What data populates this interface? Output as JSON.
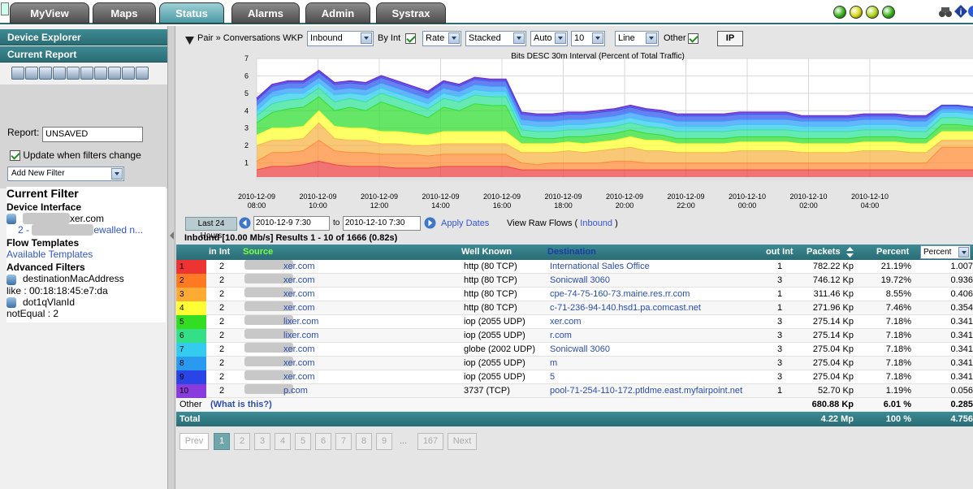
{
  "tabs": [
    {
      "label": "MyView"
    },
    {
      "label": "Maps"
    },
    {
      "label": "Status"
    },
    {
      "label": "Alarms"
    },
    {
      "label": "Admin"
    },
    {
      "label": "Systrax"
    }
  ],
  "status_balls": [
    "#2faf0c",
    "#d6d60a",
    "#a7d110",
    "#2faf0c"
  ],
  "left": {
    "device_explorer": "Device Explorer",
    "current_report": "Current Report",
    "report_label": "Report:",
    "report_value": "UNSAVED",
    "update_label": "Update when filters change",
    "add_filter": "Add New Filter",
    "current_filter": "Current Filter",
    "device_interface": "Device Interface",
    "device_host": "xer.com",
    "device_iface": "2 -",
    "device_iface_tail": "ewalled n...",
    "flow_templates": "Flow Templates",
    "available_templates": "Available Templates",
    "advanced_filters": "Advanced Filters",
    "filter1_name": "destinationMacAddress",
    "filter1_value": "like : 00:18:18:45:e7:da",
    "filter2_name": "dot1qVlanId",
    "filter2_value": "notEqual : 2"
  },
  "controls": {
    "pair_label": "Pair » Conversations WKP",
    "direction": "Inbound",
    "by_int": "By Int",
    "rate": "Rate",
    "stacked": "Stacked",
    "auto": "Auto",
    "count": "10",
    "line": "Line",
    "other": "Other",
    "ip": "IP"
  },
  "chart_data": {
    "type": "area",
    "title": "Bits DESC 30m Interval (Percent of Total Traffic)",
    "y_ticks": [
      "7",
      "6",
      "5",
      "4",
      "3",
      "2",
      "1"
    ],
    "x_ticks": [
      [
        "2010-12-09",
        "08:00"
      ],
      [
        "2010-12-09",
        "10:00"
      ],
      [
        "2010-12-09",
        "12:00"
      ],
      [
        "2010-12-09",
        "14:00"
      ],
      [
        "2010-12-09",
        "16:00"
      ],
      [
        "2010-12-09",
        "18:00"
      ],
      [
        "2010-12-09",
        "20:00"
      ],
      [
        "2010-12-09",
        "22:00"
      ],
      [
        "2010-12-10",
        "00:00"
      ],
      [
        "2010-12-10",
        "02:00"
      ],
      [
        "2010-12-10",
        "04:00"
      ]
    ],
    "ylim": [
      0,
      7
    ],
    "series_colors": [
      "#ee4444",
      "#ff8c3a",
      "#f6b64a",
      "#ffff33",
      "#33dd33",
      "#33e29a",
      "#33ccee",
      "#3399ff",
      "#3355ee",
      "#6a3bd6"
    ],
    "x": [
      0,
      1,
      2,
      3,
      4,
      5,
      6,
      7,
      8,
      9,
      10,
      11,
      12,
      13,
      14,
      15,
      16,
      17,
      18,
      19,
      20,
      21,
      22,
      23,
      24,
      25,
      26,
      27,
      28,
      29,
      30,
      31,
      32,
      33,
      34,
      35,
      36,
      37,
      38,
      39,
      40,
      41,
      42,
      43,
      44,
      45,
      46
    ],
    "cumulative": [
      [
        0.6,
        0.8,
        0.8,
        0.9,
        1.1,
        0.9,
        0.8,
        0.8,
        0.8,
        0.7,
        0.7,
        0.7,
        0.8,
        0.8,
        0.8,
        0.8,
        0.8,
        0.6,
        0.6,
        0.6,
        0.6,
        0.6,
        0.6,
        0.6,
        0.6,
        0.6,
        0.6,
        0.6,
        0.6,
        0.6,
        0.6,
        0.6,
        0.6,
        0.6,
        0.6,
        0.6,
        0.6,
        0.6,
        0.6,
        0.6,
        0.6,
        0.6,
        0.6,
        0.6,
        0.6,
        0.6,
        0.6
      ],
      [
        1.1,
        1.6,
        1.6,
        1.7,
        2.3,
        1.7,
        1.6,
        1.6,
        1.5,
        1.5,
        1.5,
        1.4,
        1.5,
        1.5,
        1.5,
        1.5,
        1.5,
        1.0,
        0.9,
        1.0,
        1.0,
        1.0,
        1.0,
        1.1,
        1.1,
        1.0,
        1.0,
        1.0,
        1.0,
        1.0,
        1.0,
        1.0,
        1.0,
        1.0,
        1.0,
        1.0,
        1.0,
        1.0,
        1.0,
        1.0,
        1.0,
        1.0,
        1.0,
        1.0,
        1.9,
        1.9,
        1.9
      ],
      [
        2.0,
        2.3,
        2.3,
        2.4,
        3.3,
        2.4,
        2.3,
        2.3,
        2.1,
        2.1,
        2.0,
        2.0,
        2.1,
        2.1,
        2.1,
        2.1,
        2.1,
        1.6,
        1.6,
        1.6,
        1.7,
        1.6,
        1.7,
        1.8,
        1.9,
        1.7,
        1.7,
        1.6,
        1.6,
        1.6,
        1.6,
        1.7,
        1.7,
        1.7,
        1.7,
        1.6,
        1.6,
        1.6,
        1.6,
        1.7,
        1.7,
        1.7,
        1.6,
        1.6,
        2.3,
        2.3,
        2.3
      ],
      [
        2.6,
        3.0,
        3.0,
        3.1,
        4.0,
        3.1,
        3.0,
        3.0,
        2.8,
        2.8,
        2.7,
        2.6,
        2.8,
        2.8,
        2.8,
        2.8,
        2.8,
        2.1,
        2.1,
        2.1,
        2.2,
        2.1,
        2.2,
        2.3,
        2.5,
        2.3,
        2.3,
        2.1,
        2.1,
        2.1,
        2.1,
        2.2,
        2.2,
        2.2,
        2.2,
        2.1,
        2.1,
        2.1,
        2.1,
        2.2,
        2.2,
        2.2,
        2.1,
        2.1,
        2.8,
        2.8,
        2.8
      ],
      [
        3.3,
        3.9,
        4.1,
        4.2,
        4.8,
        4.0,
        4.2,
        4.0,
        4.5,
        4.2,
        3.9,
        3.6,
        4.2,
        4.0,
        4.4,
        4.3,
        4.3,
        2.5,
        2.4,
        2.4,
        2.5,
        2.5,
        2.6,
        2.7,
        2.9,
        2.7,
        2.6,
        2.4,
        2.4,
        2.4,
        2.4,
        2.5,
        2.5,
        2.5,
        2.5,
        2.4,
        2.4,
        2.4,
        2.4,
        2.5,
        2.5,
        2.5,
        2.4,
        2.4,
        3.2,
        3.2,
        3.1
      ],
      [
        3.7,
        4.4,
        4.6,
        4.7,
        5.3,
        4.5,
        4.7,
        4.5,
        5.0,
        4.7,
        4.4,
        4.1,
        4.7,
        4.5,
        4.9,
        4.8,
        4.8,
        2.9,
        2.8,
        2.8,
        2.9,
        2.9,
        3.0,
        3.1,
        3.3,
        3.1,
        3.0,
        2.8,
        2.8,
        2.8,
        2.8,
        2.9,
        2.9,
        2.9,
        2.9,
        2.8,
        2.8,
        2.8,
        2.8,
        2.9,
        2.9,
        2.9,
        2.8,
        2.8,
        3.6,
        3.6,
        3.5
      ],
      [
        4.0,
        4.8,
        5.0,
        5.0,
        5.6,
        4.9,
        5.0,
        4.9,
        5.3,
        5.0,
        4.7,
        4.4,
        5.0,
        4.8,
        5.2,
        5.1,
        5.1,
        3.2,
        3.1,
        3.1,
        3.2,
        3.2,
        3.3,
        3.4,
        3.6,
        3.4,
        3.3,
        3.1,
        3.1,
        3.1,
        3.1,
        3.2,
        3.2,
        3.2,
        3.2,
        3.1,
        3.1,
        3.1,
        3.1,
        3.2,
        3.2,
        3.2,
        3.1,
        3.1,
        3.9,
        3.9,
        3.8
      ],
      [
        4.3,
        5.1,
        5.3,
        5.3,
        5.9,
        5.2,
        5.3,
        5.2,
        5.6,
        5.3,
        5.0,
        4.7,
        5.3,
        5.1,
        5.5,
        5.4,
        5.4,
        3.5,
        3.4,
        3.4,
        3.5,
        3.5,
        3.6,
        3.7,
        3.9,
        3.7,
        3.6,
        3.4,
        3.4,
        3.4,
        3.4,
        3.5,
        3.5,
        3.5,
        3.5,
        3.4,
        3.4,
        3.4,
        3.4,
        3.5,
        3.5,
        3.5,
        3.4,
        3.4,
        4.1,
        4.1,
        4.0
      ],
      [
        4.6,
        5.4,
        5.6,
        5.6,
        6.2,
        5.5,
        5.6,
        5.5,
        5.9,
        5.6,
        5.3,
        5.0,
        5.6,
        5.4,
        5.8,
        5.7,
        5.7,
        3.8,
        3.7,
        3.7,
        3.8,
        3.8,
        3.9,
        4.0,
        4.2,
        4.0,
        3.9,
        3.7,
        3.7,
        3.7,
        3.7,
        3.8,
        3.8,
        3.8,
        3.8,
        3.6,
        3.6,
        3.6,
        3.6,
        3.7,
        3.7,
        3.7,
        3.6,
        3.6,
        4.3,
        4.3,
        4.2
      ],
      [
        4.7,
        5.5,
        5.7,
        5.7,
        6.3,
        5.6,
        5.7,
        5.6,
        6.0,
        5.7,
        5.4,
        5.1,
        5.7,
        5.5,
        5.9,
        5.8,
        5.8,
        3.9,
        3.8,
        3.8,
        3.9,
        3.9,
        4.0,
        4.1,
        4.3,
        4.1,
        4.0,
        3.8,
        3.8,
        3.8,
        3.8,
        3.9,
        3.9,
        3.9,
        3.9,
        3.7,
        3.7,
        3.7,
        3.7,
        3.8,
        3.8,
        3.8,
        3.7,
        3.7,
        4.3,
        4.3,
        4.2
      ]
    ],
    "grid": true
  },
  "time": {
    "range_button": "Last 24 Hours",
    "start": "2010-12-9 7:30",
    "to": "to",
    "end": "2010-12-10 7:30",
    "apply": "Apply Dates",
    "raw_flows": "View Raw Flows (",
    "raw_flows_link": "Inbound",
    "raw_flows_close": ")"
  },
  "results_title": "Inbound [10.00 Mb/s] Results 1 - 10 of 1666 (0.82s)",
  "table": {
    "headers": {
      "in_int": "in Int",
      "source": "Source",
      "well_known": "Well Known",
      "destination": "Destination",
      "out_int": "out Int",
      "packets": "Packets",
      "percent": "Percent",
      "percent_select": "Percent"
    },
    "rows": [
      {
        "n": "1",
        "color": "#ee3333",
        "in": "2",
        "src": "xer.com",
        "wk": "http (80 TCP)",
        "dst": "International Sales Office",
        "out": "1",
        "pk": "782.22 Kp",
        "pct": "21.19%",
        "val": "1.007"
      },
      {
        "n": "2",
        "color": "#ff7a22",
        "in": "2",
        "src": "xer.com",
        "wk": "http (80 TCP)",
        "dst": "Sonicwall 3060",
        "out": "3",
        "pk": "746.12 Kp",
        "pct": "19.72%",
        "val": "0.936"
      },
      {
        "n": "3",
        "color": "#ffaa33",
        "in": "2",
        "src": "xer.com",
        "wk": "http (80 TCP)",
        "dst": "cpe-74-75-160-73.maine.res.rr.com",
        "out": "1",
        "pk": "311.46 Kp",
        "pct": "8.55%",
        "val": "0.406"
      },
      {
        "n": "4",
        "color": "#ffff33",
        "in": "2",
        "src": "xer.com",
        "wk": "http (80 TCP)",
        "dst": "c-71-236-94-140.hsd1.pa.comcast.net",
        "out": "1",
        "pk": "271.96 Kp",
        "pct": "7.46%",
        "val": "0.354"
      },
      {
        "n": "5",
        "color": "#33dd22",
        "in": "2",
        "src": "lixer.com",
        "wk": "iop (2055 UDP)",
        "dst": "xer.com",
        "out": "3",
        "pk": "275.14 Kp",
        "pct": "7.18%",
        "val": "0.341"
      },
      {
        "n": "6",
        "color": "#33e088",
        "in": "2",
        "src": "lixer.com",
        "wk": "iop (2055 UDP)",
        "dst": "r.com",
        "out": "3",
        "pk": "275.14 Kp",
        "pct": "7.18%",
        "val": "0.341"
      },
      {
        "n": "7",
        "color": "#33ccee",
        "in": "2",
        "src": "xer.com",
        "wk": "globe (2002 UDP)",
        "dst": "Sonicwall 3060",
        "out": "3",
        "pk": "275.04 Kp",
        "pct": "7.18%",
        "val": "0.341"
      },
      {
        "n": "8",
        "color": "#2a9af0",
        "in": "2",
        "src": "xer.com",
        "wk": "iop (2055 UDP)",
        "dst": "m",
        "out": "3",
        "pk": "275.04 Kp",
        "pct": "7.18%",
        "val": "0.341"
      },
      {
        "n": "9",
        "color": "#2a44e6",
        "in": "2",
        "src": "xer.com",
        "wk": "iop (2055 UDP)",
        "dst": "5",
        "out": "3",
        "pk": "275.04 Kp",
        "pct": "7.18%",
        "val": "0.341"
      },
      {
        "n": "10",
        "color": "#8a3bdd",
        "in": "2",
        "src": "p.com",
        "wk": "3737 (TCP)",
        "dst": "pool-71-254-110-172.ptldme.east.myfairpoint.net",
        "out": "1",
        "pk": "52.70 Kp",
        "pct": "1.19%",
        "val": "0.056"
      }
    ],
    "other": {
      "label": "Other",
      "link": "(What is this?)",
      "pk": "680.88 Kp",
      "pct": "6.01 %",
      "val": "0.285"
    },
    "total": {
      "label": "Total",
      "pk": "4.22 Mp",
      "pct": "100 %",
      "val": "4.756"
    }
  },
  "pager": {
    "prev": "Prev",
    "pages": [
      "1",
      "2",
      "3",
      "4",
      "5",
      "6",
      "7",
      "8",
      "9"
    ],
    "ellipsis": "...",
    "last": "167",
    "next": "Next"
  }
}
